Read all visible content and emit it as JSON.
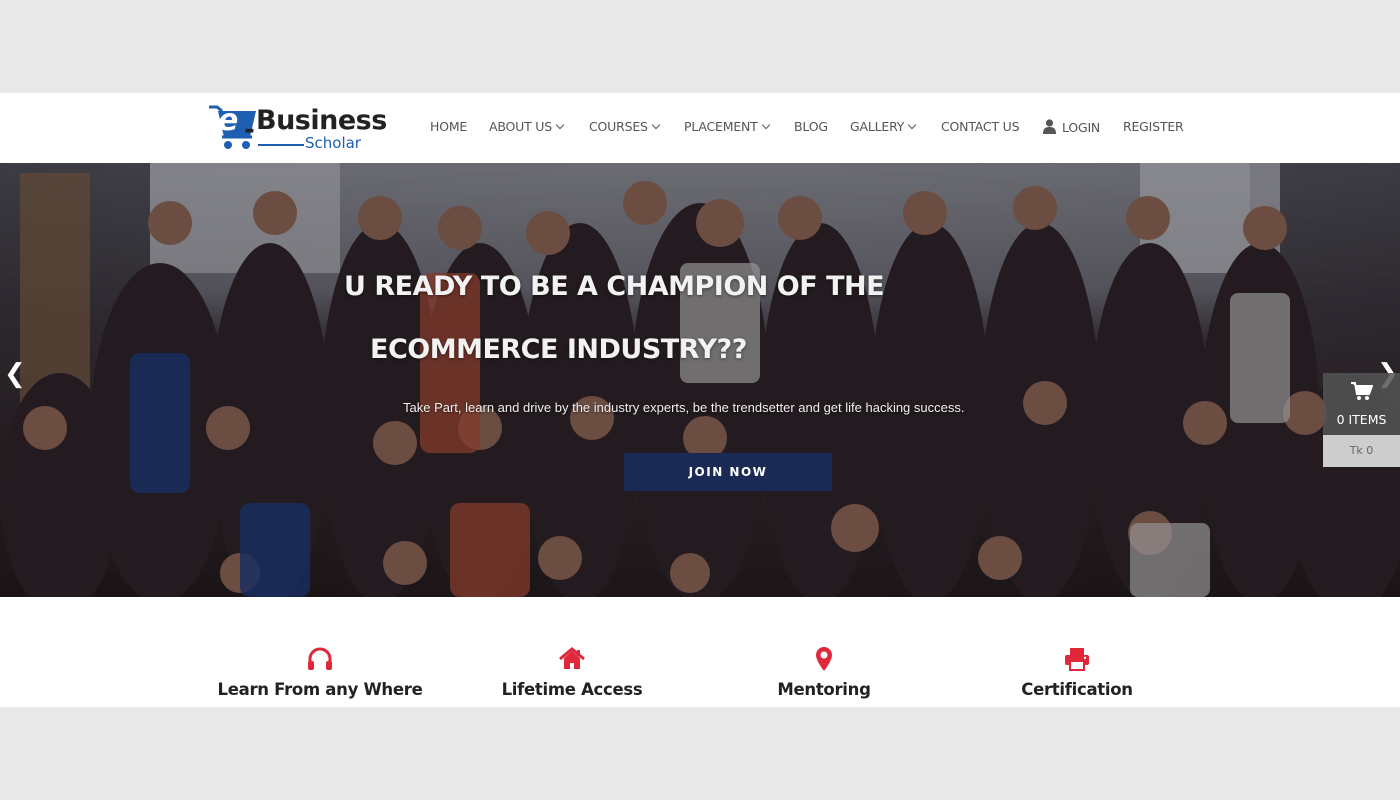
{
  "header": {
    "logo": {
      "brand_top": "Business",
      "brand_prefix": "e",
      "brand_bottom": "Scholar"
    },
    "nav": [
      {
        "label": "HOME",
        "dropdown": false
      },
      {
        "label": "ABOUT US",
        "dropdown": true
      },
      {
        "label": "COURSES",
        "dropdown": true
      },
      {
        "label": "PLACEMENT",
        "dropdown": true
      },
      {
        "label": "BLOG",
        "dropdown": false
      },
      {
        "label": "GALLERY",
        "dropdown": true
      },
      {
        "label": "CONTACT US",
        "dropdown": false
      },
      {
        "label": "LOGIN",
        "icon": "user-icon"
      },
      {
        "label": "REGISTER",
        "dropdown": false
      }
    ]
  },
  "hero": {
    "title_line_1": "U READY TO BE A CHAMPION OF THE",
    "title_line_2": "ECOMMERCE INDUSTRY??",
    "subtitle": "Take Part, learn and drive by the industry experts, be the trendsetter and get life hacking success.",
    "cta_label": "JOIN NOW",
    "prev_arrow": "❮",
    "next_arrow": "❯",
    "cta_color": "#1b2a55"
  },
  "cart": {
    "items_label": "0 ITEMS",
    "total_label": "Tk 0",
    "icon": "shopping-cart-icon"
  },
  "features": [
    {
      "title": "Learn From any Where",
      "icon": "headphones-icon"
    },
    {
      "title": "Lifetime Access",
      "icon": "home-icon"
    },
    {
      "title": "Mentoring",
      "icon": "map-marker-icon"
    },
    {
      "title": "Certification",
      "icon": "printer-icon"
    }
  ],
  "colors": {
    "accent_red": "#e0283a",
    "brand_blue": "#1f5fb3",
    "nav_text": "#555555"
  }
}
